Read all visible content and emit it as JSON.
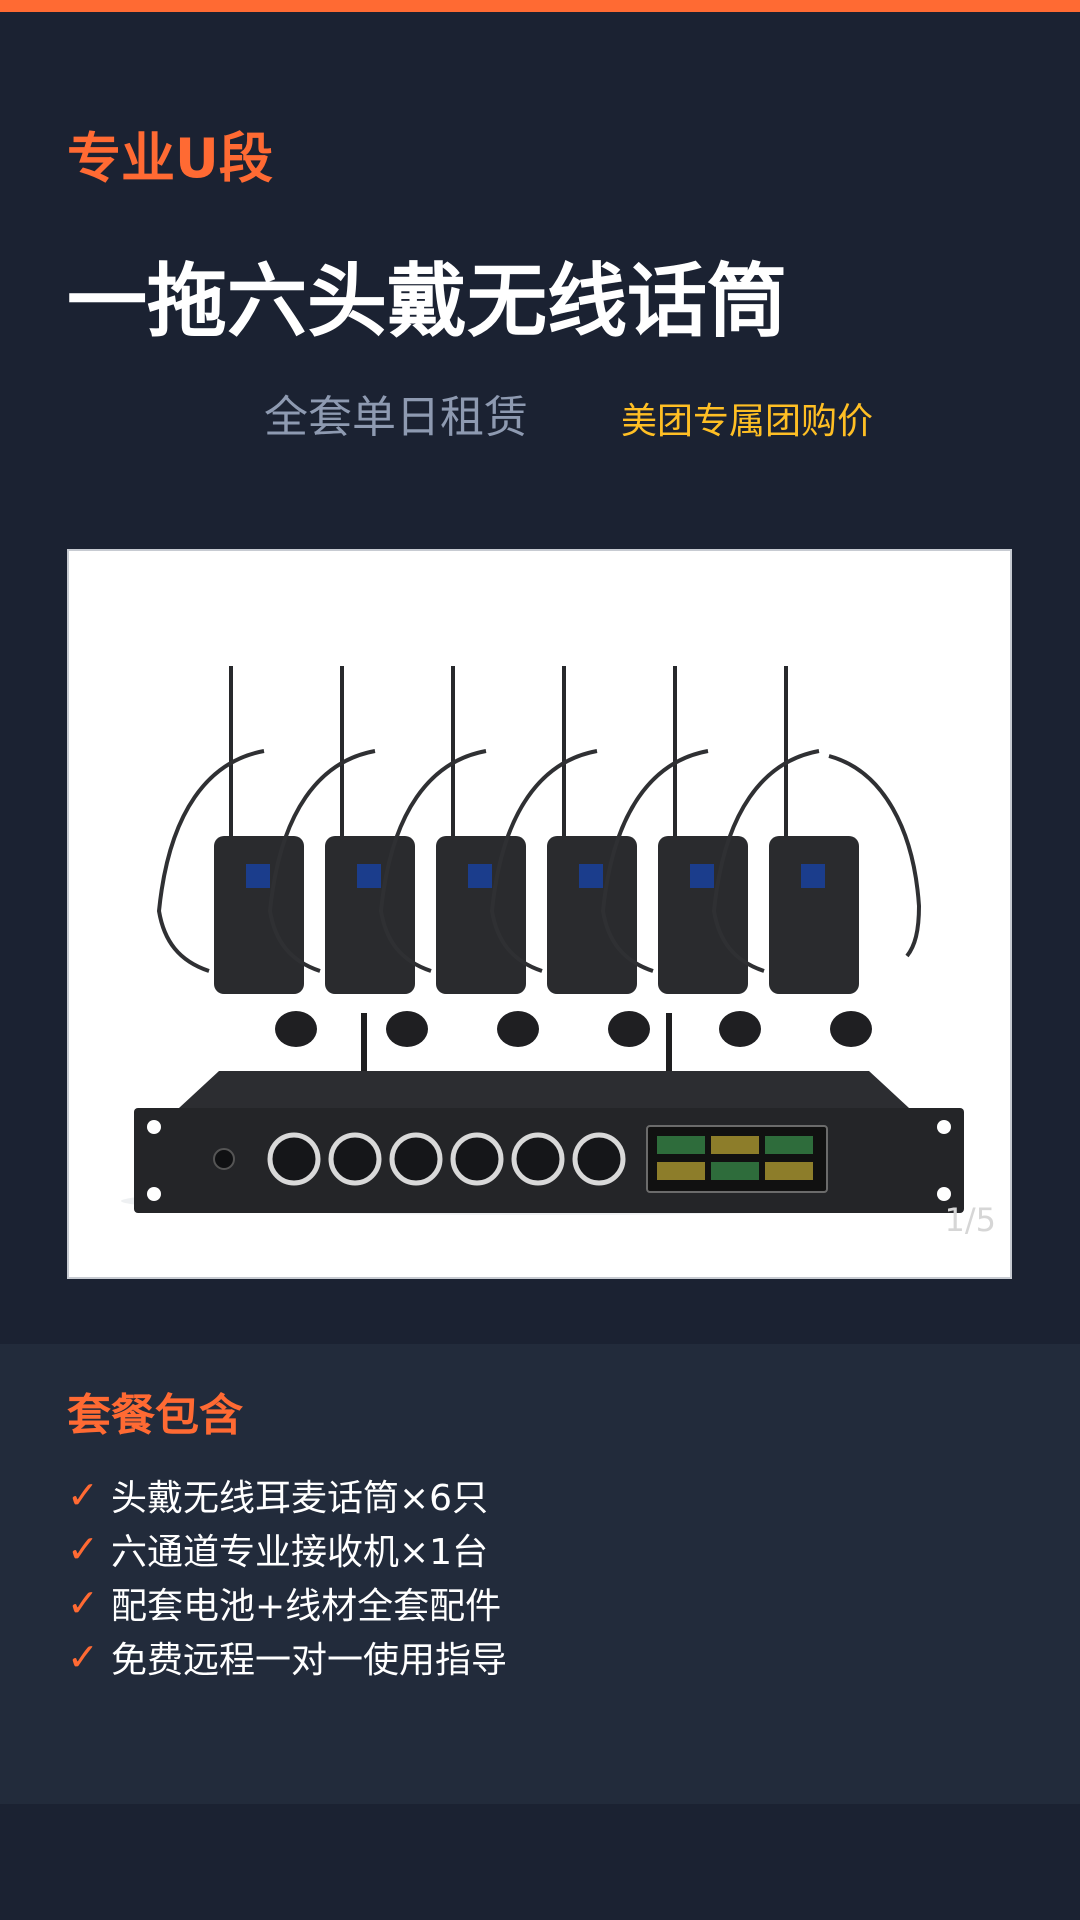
{
  "header": {
    "tagline": "专业U段",
    "title": "一拖六头戴无线话筒",
    "subtitle": "全套单日租赁",
    "badge": "美团专属团购价"
  },
  "product_image": {
    "page_indicator": "1/5"
  },
  "package": {
    "title": "套餐包含",
    "items": [
      "头戴无线耳麦话筒×6只",
      "六通道专业接收机×1台",
      "配套电池+线材全套配件",
      "免费远程一对一使用指导"
    ]
  },
  "colors": {
    "background": "#1b2232",
    "panel": "#222b3b",
    "accent": "#ff6a33",
    "badge": "#ffbf24",
    "subtitle": "#8e9ab1"
  }
}
